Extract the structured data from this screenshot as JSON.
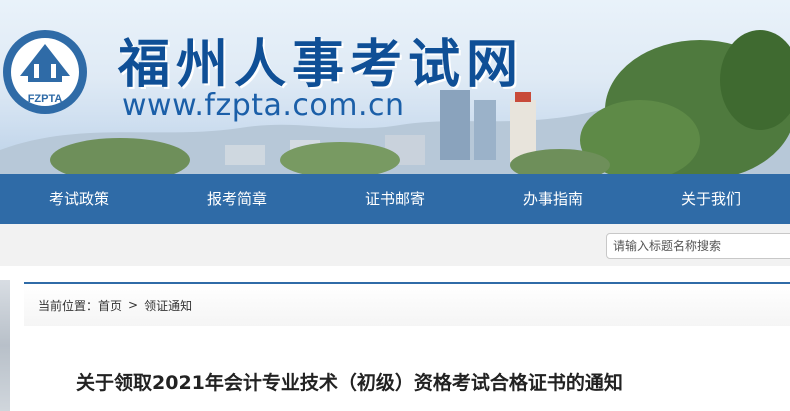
{
  "header": {
    "logo_text": "FZPTA",
    "site_name": "福州人事考试网",
    "site_url": "www.fzpta.com.cn"
  },
  "nav": {
    "items": [
      {
        "label": "考试政策"
      },
      {
        "label": "报考简章"
      },
      {
        "label": "证书邮寄"
      },
      {
        "label": "办事指南"
      },
      {
        "label": "关于我们"
      }
    ]
  },
  "search": {
    "placeholder": "请输入标题名称搜索"
  },
  "breadcrumb": {
    "prefix": "当前位置：",
    "home": "首页",
    "separator": ">",
    "current": "领证通知"
  },
  "article": {
    "title": "关于领取2021年会计专业技术（初级）资格考试合格证书的通知"
  },
  "colors": {
    "nav_bg": "#2f6ba7",
    "brand_blue": "#0f4f96"
  }
}
